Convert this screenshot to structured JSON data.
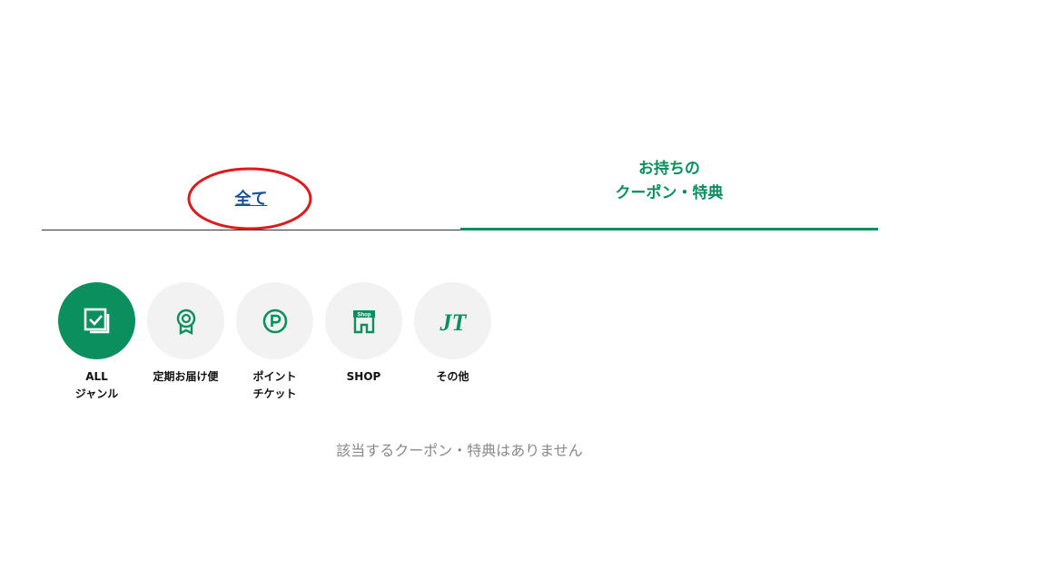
{
  "tabs": {
    "all_label": "全て",
    "owned_line1": "お持ちの",
    "owned_line2": "クーポン・特典"
  },
  "genres": [
    {
      "line1": "ALL",
      "line2": "ジャンル",
      "icon": "checkbox-stack-icon",
      "active": true
    },
    {
      "line1": "定期お届け便",
      "line2": "",
      "icon": "award-ribbon-icon",
      "active": false
    },
    {
      "line1": "ポイント",
      "line2": "チケット",
      "icon": "point-p-icon",
      "active": false
    },
    {
      "line1": "SHOP",
      "line2": "",
      "icon": "shop-storefront-icon",
      "active": false
    },
    {
      "line1": "その他",
      "line2": "",
      "icon": "jt-logo-icon",
      "active": false
    }
  ],
  "shop_icon_text": "Shop",
  "jt_logo_text": "JT",
  "empty_message": "該当するクーポン・特典はありません",
  "colors": {
    "brand_green": "#0b8f5e",
    "link_blue": "#1a4fa0",
    "annotation_red": "#e01a1a"
  }
}
